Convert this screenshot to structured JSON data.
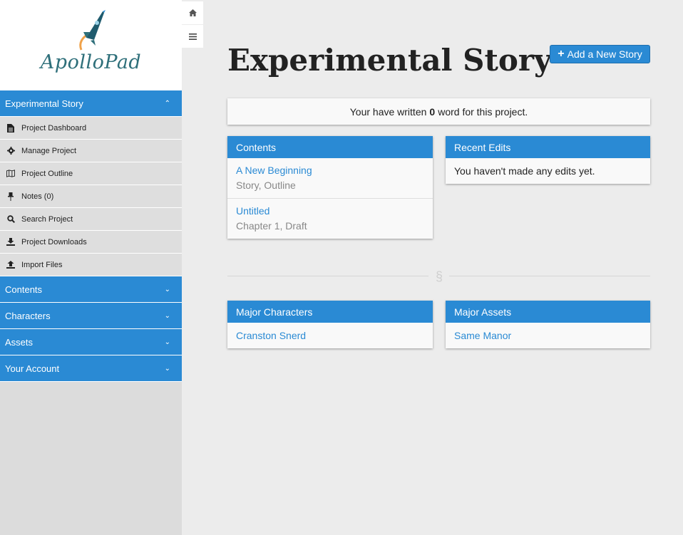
{
  "app": {
    "logo_text": "ApolloPad"
  },
  "sidebar": {
    "project": {
      "label": "Experimental Story"
    },
    "items": [
      {
        "label": "Project Dashboard",
        "icon": "file-icon"
      },
      {
        "label": "Manage Project",
        "icon": "gear-icon"
      },
      {
        "label": "Project Outline",
        "icon": "map-icon"
      },
      {
        "label": "Notes (0)",
        "icon": "pin-icon"
      },
      {
        "label": "Search Project",
        "icon": "search-icon"
      },
      {
        "label": "Project Downloads",
        "icon": "download-icon"
      },
      {
        "label": "Import Files",
        "icon": "upload-icon"
      }
    ],
    "sections": [
      {
        "label": "Contents"
      },
      {
        "label": "Characters"
      },
      {
        "label": "Assets"
      },
      {
        "label": "Your Account"
      }
    ]
  },
  "main": {
    "title": "Experimental Story",
    "add_button": "Add a New Story",
    "words": {
      "prefix": "Your have written",
      "count": "0",
      "suffix": "word for this project."
    },
    "contents": {
      "title": "Contents",
      "items": [
        {
          "title": "A New Beginning",
          "meta": "Story, Outline"
        },
        {
          "title": "Untitled",
          "meta": "Chapter 1, Draft"
        }
      ]
    },
    "recent": {
      "title": "Recent Edits",
      "empty": "You haven't made any edits yet."
    },
    "divider_symbol": "§",
    "characters": {
      "title": "Major Characters",
      "items": [
        {
          "name": "Cranston Snerd"
        }
      ]
    },
    "assets": {
      "title": "Major Assets",
      "items": [
        {
          "name": "Same Manor"
        }
      ]
    }
  },
  "colors": {
    "accent": "#2a8ad4",
    "sidebar_bg": "#dcdcdc",
    "page_bg": "#ececec"
  }
}
